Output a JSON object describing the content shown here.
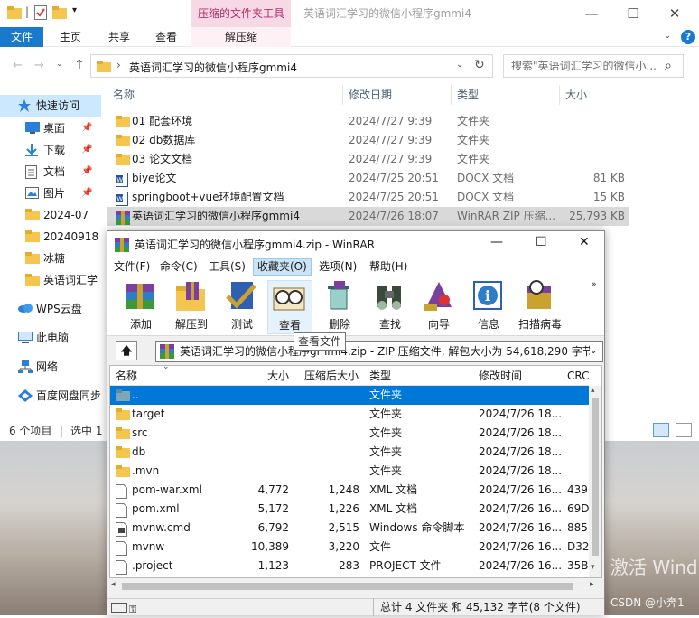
{
  "explorer": {
    "context_tab_group": "压缩的文件夹工具",
    "window_title": "英语词汇学习的微信小程序gmmi4",
    "ribbon_tabs": [
      "文件",
      "主页",
      "共享",
      "查看"
    ],
    "context_tab": "解压缩",
    "address": "英语词汇学习的微信小程序gmmi4",
    "search_placeholder": "搜索\"英语词汇学习的微信小...",
    "columns": [
      "名称",
      "修改日期",
      "类型",
      "大小"
    ],
    "files": [
      {
        "name": "01 配套环境",
        "date": "2024/7/27 9:39",
        "type": "文件夹",
        "size": "",
        "icon": "folder-icon"
      },
      {
        "name": "02 db数据库",
        "date": "2024/7/27 9:39",
        "type": "文件夹",
        "size": "",
        "icon": "folder-icon"
      },
      {
        "name": "03 论文文档",
        "date": "2024/7/27 9:39",
        "type": "文件夹",
        "size": "",
        "icon": "folder-icon"
      },
      {
        "name": "biye论文",
        "date": "2024/7/25 20:51",
        "type": "DOCX 文档",
        "size": "81 KB",
        "icon": "word-doc-icon"
      },
      {
        "name": "springboot+vue环境配置文档",
        "date": "2024/7/25 20:51",
        "type": "DOCX 文档",
        "size": "15 KB",
        "icon": "word-doc-icon"
      },
      {
        "name": "英语词汇学习的微信小程序gmmi4",
        "date": "2024/7/26 18:07",
        "type": "WinRAR ZIP 压缩...",
        "size": "25,793 KB",
        "icon": "winrar-archive-icon"
      }
    ],
    "nav": [
      {
        "label": "快速访问",
        "icon": "star-icon"
      },
      {
        "label": "桌面",
        "icon": "desktop-icon"
      },
      {
        "label": "下载",
        "icon": "download-icon"
      },
      {
        "label": "文档",
        "icon": "documents-icon"
      },
      {
        "label": "图片",
        "icon": "pictures-icon"
      },
      {
        "label": "2024-07",
        "icon": "folder-icon"
      },
      {
        "label": "20240918",
        "icon": "folder-icon"
      },
      {
        "label": "冰糖",
        "icon": "folder-icon"
      },
      {
        "label": "英语词汇学",
        "icon": "folder-icon"
      },
      {
        "label": "WPS云盘",
        "icon": "cloud-icon"
      },
      {
        "label": "此电脑",
        "icon": "computer-icon"
      },
      {
        "label": "网络",
        "icon": "network-icon"
      },
      {
        "label": "百度网盘同步",
        "icon": "baidu-netdisk-icon"
      }
    ],
    "status_count": "6 个项目",
    "status_selected": "选中 1"
  },
  "winrar": {
    "title": "英语词汇学习的微信小程序gmmi4.zip - WinRAR",
    "menu": [
      "文件(F)",
      "命令(C)",
      "工具(S)",
      "收藏夹(O)",
      "选项(N)",
      "帮助(H)"
    ],
    "toolbar": [
      {
        "label": "添加",
        "icon": "add-archive-icon"
      },
      {
        "label": "解压到",
        "icon": "extract-to-icon"
      },
      {
        "label": "测试",
        "icon": "test-icon"
      },
      {
        "label": "查看",
        "icon": "view-icon"
      },
      {
        "label": "删除",
        "icon": "delete-icon"
      },
      {
        "label": "查找",
        "icon": "find-icon"
      },
      {
        "label": "向导",
        "icon": "wizard-icon"
      },
      {
        "label": "信息",
        "icon": "info-icon"
      },
      {
        "label": "扫描病毒",
        "icon": "virus-scan-icon"
      }
    ],
    "path": "英语词汇学习的微信小程序gmmi4.zip - ZIP 压缩文件, 解包大小为 54,618,290 字节",
    "tooltip": "查看文件",
    "columns": [
      "名称",
      "大小",
      "压缩后大小",
      "类型",
      "修改时间",
      "CRC"
    ],
    "rows": [
      {
        "name": "..",
        "size": "",
        "packed": "",
        "type": "文件夹",
        "time": "",
        "crc": "",
        "icon": "parent-folder-icon"
      },
      {
        "name": "target",
        "size": "",
        "packed": "",
        "type": "文件夹",
        "time": "2024/7/26 18...",
        "crc": "",
        "icon": "folder-icon"
      },
      {
        "name": "src",
        "size": "",
        "packed": "",
        "type": "文件夹",
        "time": "2024/7/26 18...",
        "crc": "",
        "icon": "folder-icon"
      },
      {
        "name": "db",
        "size": "",
        "packed": "",
        "type": "文件夹",
        "time": "2024/7/26 18...",
        "crc": "",
        "icon": "folder-icon"
      },
      {
        "name": ".mvn",
        "size": "",
        "packed": "",
        "type": "文件夹",
        "time": "2024/7/26 18...",
        "crc": "",
        "icon": "folder-icon"
      },
      {
        "name": "pom-war.xml",
        "size": "4,772",
        "packed": "1,248",
        "type": "XML 文档",
        "time": "2024/7/26 16...",
        "crc": "439",
        "icon": "file-icon"
      },
      {
        "name": "pom.xml",
        "size": "5,172",
        "packed": "1,226",
        "type": "XML 文档",
        "time": "2024/7/26 16...",
        "crc": "69D",
        "icon": "file-icon"
      },
      {
        "name": "mvnw.cmd",
        "size": "6,792",
        "packed": "2,515",
        "type": "Windows 命令脚本",
        "time": "2024/7/26 16...",
        "crc": "885",
        "icon": "script-icon"
      },
      {
        "name": "mvnw",
        "size": "10,389",
        "packed": "3,220",
        "type": "文件",
        "time": "2024/7/26 16...",
        "crc": "D32",
        "icon": "file-icon"
      },
      {
        "name": ".project",
        "size": "1,123",
        "packed": "283",
        "type": "PROJECT 文件",
        "time": "2024/7/26 16...",
        "crc": "35B",
        "icon": "file-icon"
      }
    ],
    "status": "总计 4 文件夹 和 45,132 字节(8 个文件)"
  },
  "overlay": {
    "watermark": "激活 Wind",
    "credit": "CSDN @小奔1"
  },
  "colors": {
    "accent": "#0078d7",
    "file_tab": "#1979ca",
    "context_tab": "#f7d9e6",
    "folder": "#f4c64f"
  }
}
